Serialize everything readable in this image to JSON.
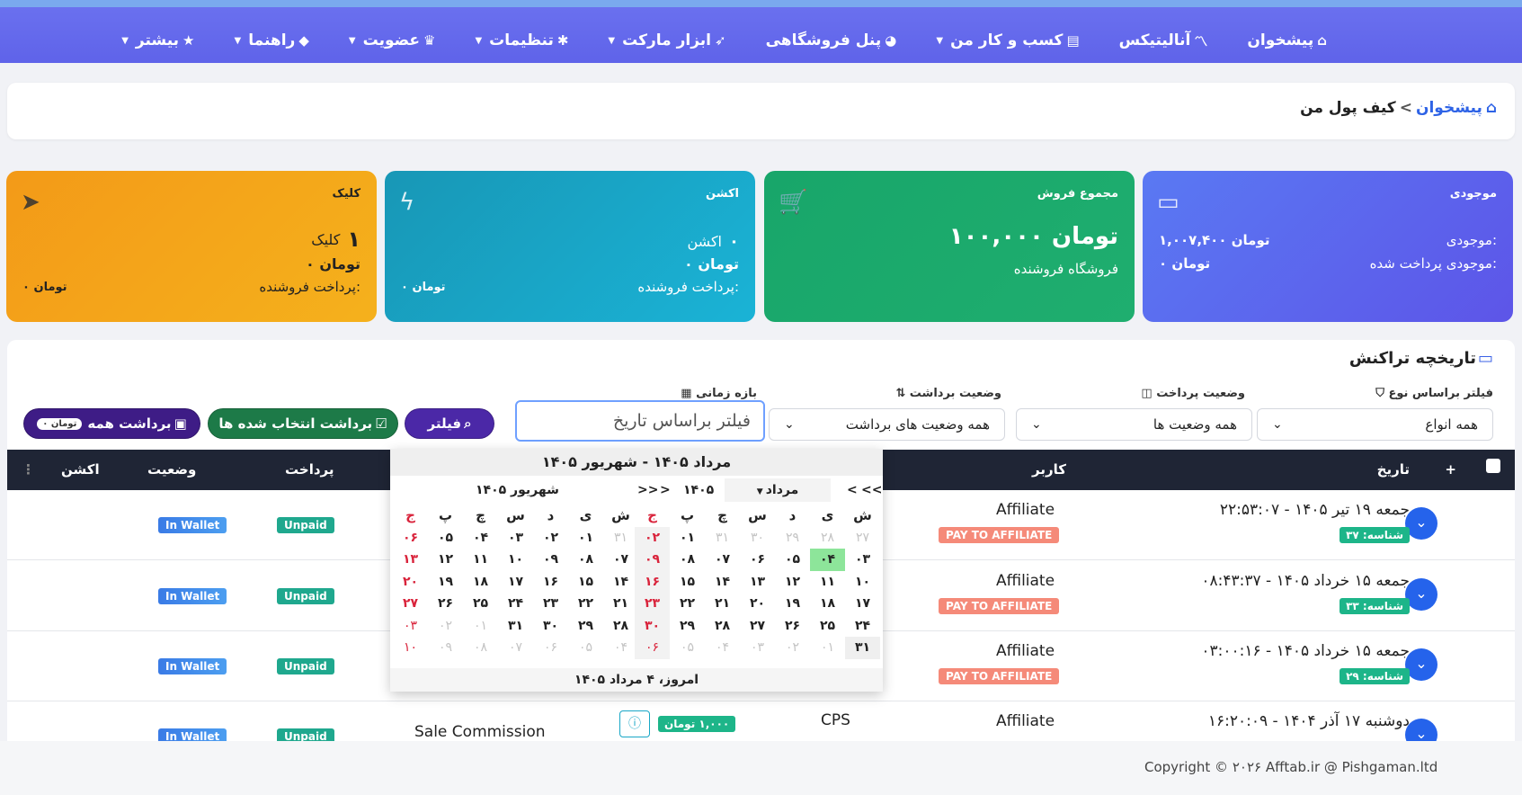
{
  "nav": {
    "items": [
      {
        "label": "پیشخوان",
        "icon": "⌂",
        "caret": ""
      },
      {
        "label": "آنالیتیکس",
        "icon": "〽",
        "caret": ""
      },
      {
        "label": "کسب و کار من",
        "icon": "▤",
        "caret": "▼"
      },
      {
        "label": "پنل فروشگاهی",
        "icon": "◕",
        "caret": ""
      },
      {
        "label": "ابزار مارکت",
        "icon": "➶",
        "caret": "▼"
      },
      {
        "label": "تنظیمات",
        "icon": "✱",
        "caret": "▼"
      },
      {
        "label": "عضویت",
        "icon": "♛",
        "caret": "▼"
      },
      {
        "label": "راهنما",
        "icon": "◆",
        "caret": "▼"
      },
      {
        "label": "بیشتر",
        "icon": "★",
        "caret": "▼"
      }
    ]
  },
  "breadcrumb": {
    "home": "پیشخوان",
    "separator": "<",
    "current": "کیف پول من"
  },
  "stats": {
    "balance": {
      "title": "موجودی",
      "label1": "موجودی:",
      "value1": "۱,۰۰۷,۴۰۰ تومان",
      "label2": "موجودی پرداخت شده:",
      "value2": "۰ تومان"
    },
    "sales": {
      "title": "مجموع فروش",
      "amount": "۱۰۰,۰۰۰ تومان",
      "sub": "فروشگاه فروشنده"
    },
    "action": {
      "title": "اکشن",
      "count": "۰",
      "count_label": "اکشن",
      "amount": "۰ تومان",
      "pay_label": "پرداخت فروشنده:",
      "pay_value": "۰ تومان"
    },
    "click": {
      "title": "کلیک",
      "count": "۱",
      "count_label": "کلیک",
      "amount": "۰ تومان",
      "pay_label": "پرداخت فروشنده:",
      "pay_value": "۰ تومان"
    }
  },
  "history": {
    "title": "تاریخچه تراکنش",
    "filters": {
      "type_label": "فیلتر براساس نوع",
      "type_value": "همه انواع",
      "pay_label": "وضعیت پرداخت",
      "pay_value": "همه وضعیت ها",
      "withdraw_label": "وضعیت برداشت",
      "withdraw_value": "همه وضعیت های برداشت",
      "date_label": "بازه زمانی",
      "date_value": "فیلتر براساس تاریخ"
    },
    "buttons": {
      "filter": "فیلتر",
      "withdraw_selected": "برداشت انتخاب شده ها",
      "withdraw_all": "برداشت همه",
      "withdraw_all_pill": "تومان ۰"
    },
    "columns": {
      "plus": "+",
      "date": "تاریخ",
      "user": "کاربر",
      "payment": "پرداخت",
      "status": "وضعیت",
      "action": "اکشن"
    },
    "rows": [
      {
        "date": "جمعه ۱۹ تیر ۱۴۰۵ - ۲۲:۵۳:۰۷",
        "id": "شناسه: ۳۷",
        "user": "Affiliate",
        "badge": "PAY TO AFFILIATE",
        "payment": "Unpaid",
        "status": "In Wallet"
      },
      {
        "date": "جمعه ۱۵ خرداد ۱۴۰۵ - ۰۸:۴۳:۳۷",
        "id": "شناسه: ۳۳",
        "user": "Affiliate",
        "badge": "PAY TO AFFILIATE",
        "payment": "Unpaid",
        "status": "In Wallet"
      },
      {
        "date": "جمعه ۱۵ خرداد ۱۴۰۵ - ۰۳:۰۰:۱۶",
        "id": "شناسه: ۲۹",
        "user": "Affiliate",
        "badge": "PAY TO AFFILIATE",
        "payment": "Unpaid",
        "status": "In Wallet"
      },
      {
        "date": "دوشنبه ۱۷ آذر ۱۴۰۴ - ۱۶:۲۰:۰۹",
        "id": "",
        "user": "Affiliate",
        "badge": "",
        "payment": "Unpaid",
        "status": "In Wallet",
        "type": "CPS",
        "amount": "۱,۰۰۰ تومان",
        "description": "Sale Commission"
      }
    ]
  },
  "calendar": {
    "range": "مرداد ۱۴۰۵ - شهریور ۱۴۰۵",
    "left_month": "شهریور ۱۴۰۵",
    "right_month": "مرداد",
    "right_year": "۱۴۰۵",
    "nav_prev": "<<",
    "nav_prev1": "<",
    "nav_next1": ">",
    "nav_next": ">>",
    "weekdays": [
      "ش",
      "ی",
      "د",
      "س",
      "چ",
      "پ",
      "ج"
    ],
    "right_days": [
      [
        "۲۷",
        "۲۸",
        "۲۹",
        "۳۰",
        "۳۱",
        "۰۱",
        "۰۲"
      ],
      [
        "۰۳",
        "۰۴",
        "۰۵",
        "۰۶",
        "۰۷",
        "۰۸",
        "۰۹"
      ],
      [
        "۱۰",
        "۱۱",
        "۱۲",
        "۱۳",
        "۱۴",
        "۱۵",
        "۱۶"
      ],
      [
        "۱۷",
        "۱۸",
        "۱۹",
        "۲۰",
        "۲۱",
        "۲۲",
        "۲۳"
      ],
      [
        "۲۴",
        "۲۵",
        "۲۶",
        "۲۷",
        "۲۸",
        "۲۹",
        "۳۰"
      ],
      [
        "۳۱",
        "۰۱",
        "۰۲",
        "۰۳",
        "۰۴",
        "۰۵",
        "۰۶"
      ]
    ],
    "left_days": [
      [
        "۳۱",
        "۰۱",
        "۰۲",
        "۰۳",
        "۰۴",
        "۰۵",
        "۰۶"
      ],
      [
        "۰۷",
        "۰۸",
        "۰۹",
        "۱۰",
        "۱۱",
        "۱۲",
        "۱۳"
      ],
      [
        "۱۴",
        "۱۵",
        "۱۶",
        "۱۷",
        "۱۸",
        "۱۹",
        "۲۰"
      ],
      [
        "۲۱",
        "۲۲",
        "۲۳",
        "۲۴",
        "۲۵",
        "۲۶",
        "۲۷"
      ],
      [
        "۲۸",
        "۲۹",
        "۳۰",
        "۳۱",
        "۰۱",
        "۰۲",
        "۰۳"
      ],
      [
        "۰۴",
        "۰۵",
        "۰۶",
        "۰۷",
        "۰۸",
        "۰۹",
        "۱۰"
      ]
    ],
    "today": "امروز، ۴ مرداد ۱۴۰۵"
  },
  "footer": {
    "copyright": "Copyright © ۲۰۲۶ Afftab.ir @ Pishgaman.ltd"
  }
}
